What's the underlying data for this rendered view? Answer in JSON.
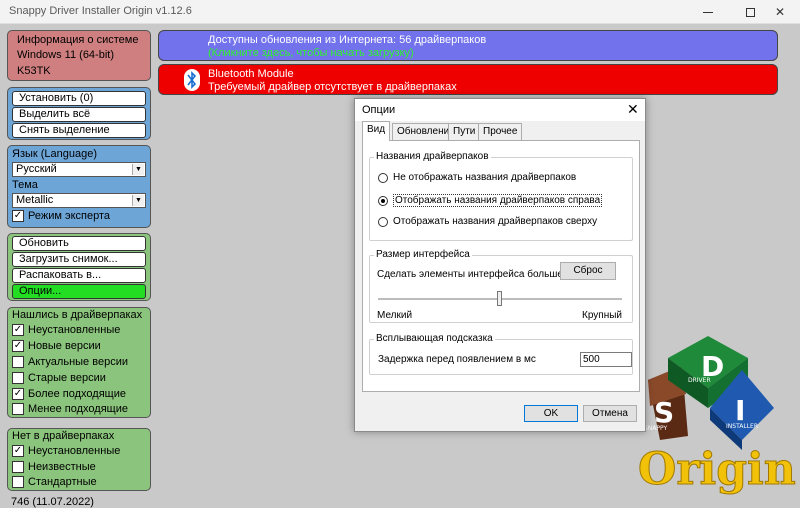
{
  "window": {
    "title": "Snappy Driver Installer Origin v1.12.6",
    "close_glyph": "✕"
  },
  "system_info": {
    "heading": "Информация о системе",
    "os": "Windows 11 (64-bit)",
    "computer": "K53TK"
  },
  "actions": {
    "install": "Установить (0)",
    "select_all": "Выделить всё",
    "deselect": "Снять выделение"
  },
  "language": {
    "label": "Язык (Language)",
    "selected": "Русский",
    "theme_label": "Тема",
    "theme_selected": "Metallic",
    "expert_mode": "Режим эксперта",
    "expert_checked": true
  },
  "tools": {
    "update": "Обновить",
    "load_snapshot": "Загрузить снимок...",
    "unpack": "Распаковать в...",
    "options": "Опции..."
  },
  "found_filters": {
    "heading": "Нашлись в драйверпаках",
    "items": [
      {
        "label": "Неустановленные",
        "checked": true
      },
      {
        "label": "Новые версии",
        "checked": true
      },
      {
        "label": "Актуальные версии",
        "checked": false
      },
      {
        "label": "Старые версии",
        "checked": false
      },
      {
        "label": "Более подходящие",
        "checked": true
      },
      {
        "label": "Менее подходящие",
        "checked": false
      }
    ]
  },
  "missing_filters": {
    "heading": "Нет в драйверпаках",
    "items": [
      {
        "label": "Неустановленные",
        "checked": true
      },
      {
        "label": "Неизвестные",
        "checked": false
      },
      {
        "label": "Стандартные",
        "checked": false
      }
    ]
  },
  "version_text": "746 (11.07.2022)",
  "updates_banner": {
    "line1": "Доступны обновления из Интернета: 56 драйверпаков",
    "line2": "(Кликните здесь, чтобы начать загрузку)"
  },
  "bluetooth_banner": {
    "line1": "Bluetooth Module",
    "line2": "Требуемый драйвер отсутствует в драйверпаках"
  },
  "dialog": {
    "title": "Опции",
    "tabs": [
      "Вид",
      "Обновления",
      "Пути",
      "Прочее"
    ],
    "names_group": {
      "label": "Названия драйверпаков",
      "options": [
        {
          "label": "Не отображать названия драйверпаков",
          "selected": false
        },
        {
          "label": "Отображать названия драйверпаков справа",
          "selected": true
        },
        {
          "label": "Отображать названия драйверпаков сверху",
          "selected": false
        }
      ]
    },
    "size_group": {
      "label": "Размер интерфейса",
      "description": "Сделать элементы интерфейса больше или мень",
      "reset": "Сброс",
      "min_label": "Мелкий",
      "max_label": "Крупный",
      "slider_value": 0.5
    },
    "tooltip_group": {
      "label": "Всплывающая подсказка",
      "delay_label": "Задержка перед появлением в мс",
      "delay_value": "500"
    },
    "ok": "OK",
    "cancel": "Отмена"
  },
  "logo": {
    "text": "Origin",
    "letters": [
      "D",
      "S",
      "I"
    ],
    "tags": [
      "DRIVER",
      "SNAPPY",
      "INSTALLER"
    ]
  },
  "colors": {
    "system_panel": "#cf7f7f",
    "blue_panel": "#6da5d7",
    "green_panel": "#8bc47c",
    "options_button": "#22dd22",
    "updates_banner": "#7272ec",
    "bluetooth_banner": "#ee0000"
  }
}
